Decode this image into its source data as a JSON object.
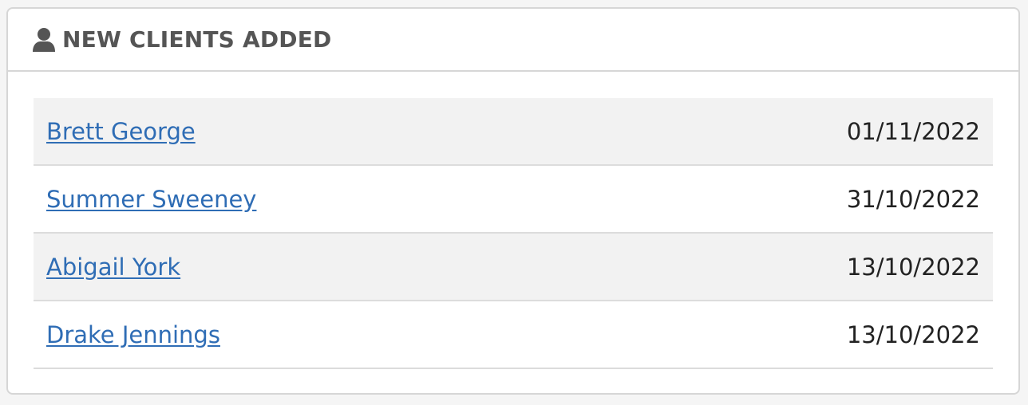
{
  "panel": {
    "title": "NEW CLIENTS ADDED",
    "icon": "user-icon"
  },
  "clients": [
    {
      "name": "Brett George",
      "date": "01/11/2022"
    },
    {
      "name": "Summer Sweeney",
      "date": "31/10/2022"
    },
    {
      "name": "Abigail York",
      "date": "13/10/2022"
    },
    {
      "name": "Drake Jennings",
      "date": "13/10/2022"
    }
  ],
  "colors": {
    "link": "#2f6db5",
    "title": "#555555",
    "row_stripe": "#f2f2f2",
    "border": "#d6d6d6"
  }
}
